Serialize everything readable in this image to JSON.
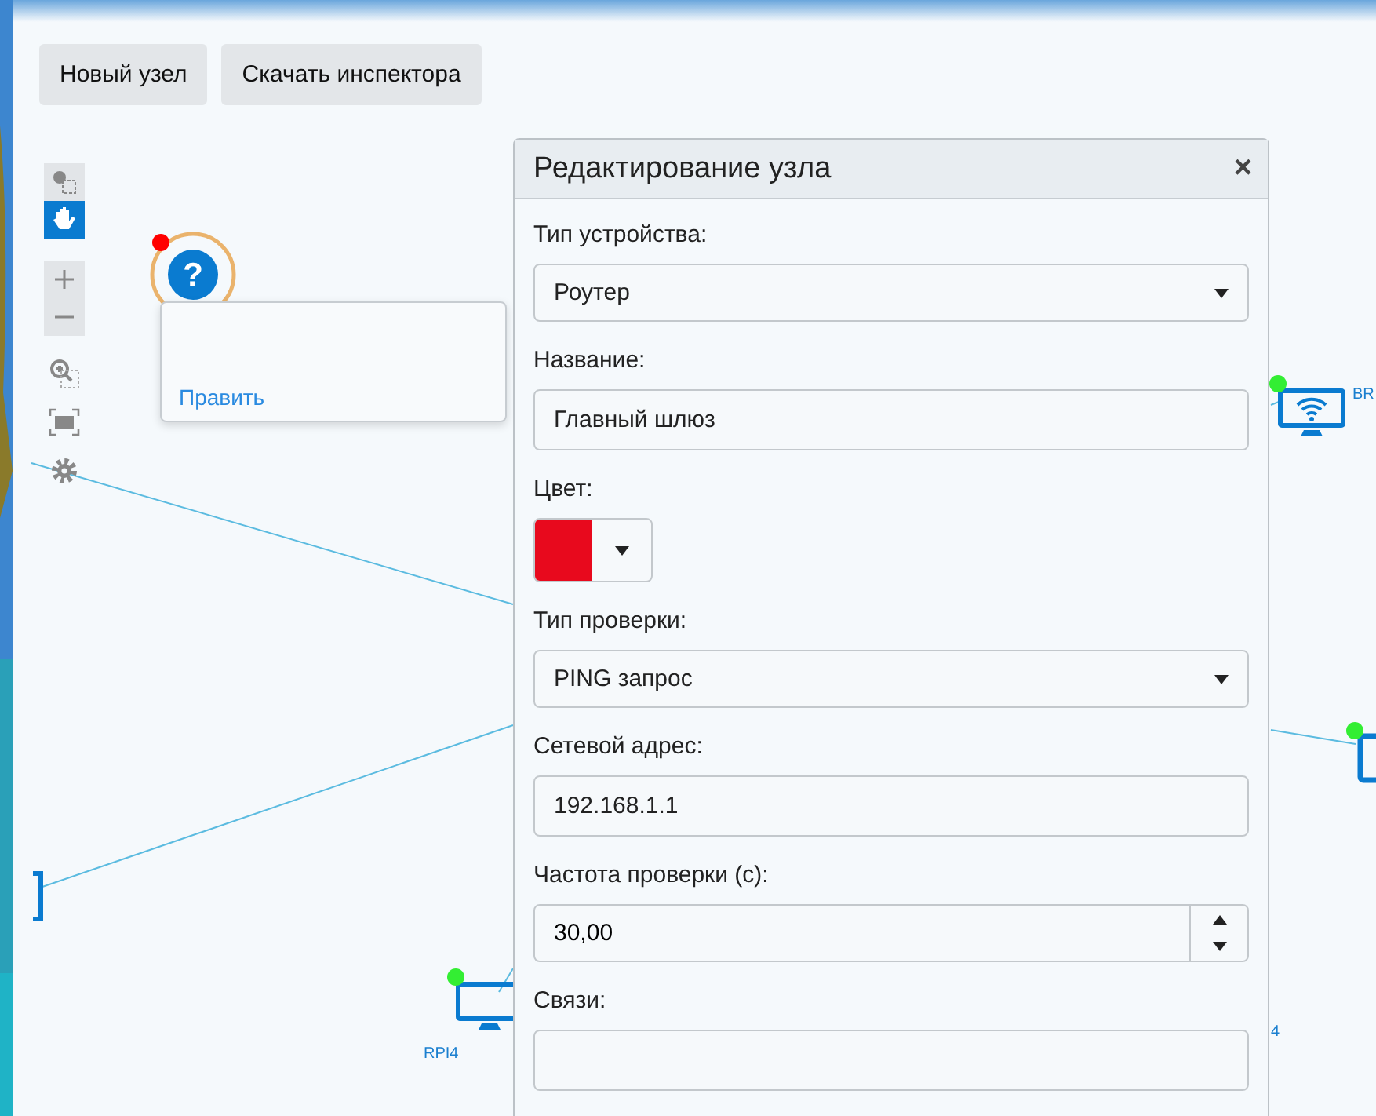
{
  "toolbar": {
    "buttons": [
      "Новый узел",
      "Скачать инспектора"
    ]
  },
  "map_tools": [
    {
      "kind": "select",
      "selected": false
    },
    {
      "kind": "pan",
      "selected": true
    }
  ],
  "nodes": [
    {
      "kind": "unknown",
      "color": "#ff0000",
      "glyph": "?"
    },
    {
      "kind": "wifi-monitor",
      "color": "#33ee33",
      "label": "BR"
    },
    {
      "kind": "box",
      "color": "#33ee33"
    },
    {
      "kind": "monitor",
      "color": "#33ee33",
      "label": "RPI4"
    },
    {
      "kind": "bracket"
    }
  ],
  "hidden_label": "4",
  "popup": {
    "link": "Править"
  },
  "dialog": {
    "title": "Редактирование узла",
    "close": "×",
    "fields": [
      {
        "kind": "select",
        "label": "Тип устройства:",
        "value": "Роутер"
      },
      {
        "kind": "text",
        "label": "Название:",
        "value": "Главный шлюз"
      },
      {
        "kind": "color",
        "label": "Цвет:",
        "color": "#e8091d"
      },
      {
        "kind": "select",
        "label": "Тип проверки:",
        "value": "PING запрос"
      },
      {
        "kind": "text",
        "label": "Сетевой адрес:",
        "value": "192.168.1.1"
      },
      {
        "kind": "number",
        "label": "Частота проверки (с):",
        "value": "30,00"
      },
      {
        "kind": "text",
        "label": "Связи:"
      }
    ]
  }
}
